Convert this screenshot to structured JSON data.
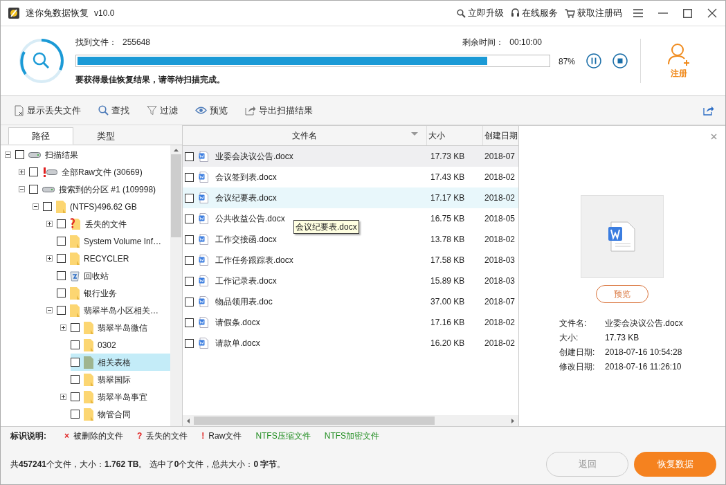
{
  "window": {
    "title": "迷你兔数据恢复",
    "version": "v10.0",
    "actions": [
      {
        "kind": "upgrade",
        "label": "立即升级"
      },
      {
        "kind": "service",
        "label": "在线服务"
      },
      {
        "kind": "cart",
        "label": "获取注册码"
      }
    ]
  },
  "scan": {
    "found_label": "找到文件：",
    "found_value": "255648",
    "remaining_label": "剩余时间：",
    "remaining_value": "00:10:00",
    "level": 0.87,
    "reading": "87%",
    "hint": "要获得最佳恢复结果，请等待扫描完成。",
    "register": "注册"
  },
  "toolbar": [
    {
      "kind": "lost",
      "label": "显示丢失文件"
    },
    {
      "kind": "search",
      "label": "查找"
    },
    {
      "kind": "filter",
      "label": "过滤"
    },
    {
      "kind": "preview",
      "label": "预览"
    },
    {
      "kind": "export",
      "label": "导出扫描结果"
    }
  ],
  "tabs": [
    {
      "label": "路径",
      "selected": true
    },
    {
      "label": "类型",
      "selected": false
    }
  ],
  "tree": [
    {
      "kind": "drive",
      "label": "扫描结果",
      "expanded": true,
      "checked": false,
      "selected": false,
      "children": [
        {
          "kind": "raw",
          "label": "全部Raw文件 (30669)",
          "expanded": false,
          "checked": false,
          "selected": false
        },
        {
          "kind": "drive",
          "label": "搜索到的分区 #1 (109998)",
          "expanded": true,
          "checked": false,
          "selected": false,
          "children": [
            {
              "kind": "folder",
              "label": "(NTFS)496.62 GB",
              "expanded": true,
              "checked": false,
              "selected": false,
              "children": [
                {
                  "kind": "lost",
                  "label": "丢失的文件",
                  "expanded": false,
                  "checked": false,
                  "selected": false
                },
                {
                  "kind": "folder",
                  "label": "System Volume Inf…",
                  "checked": false,
                  "selected": false
                },
                {
                  "kind": "folder",
                  "label": "RECYCLER",
                  "expanded": false,
                  "checked": false,
                  "selected": false
                },
                {
                  "kind": "recycle",
                  "label": "回收站",
                  "checked": false,
                  "selected": false
                },
                {
                  "kind": "folder",
                  "label": "银行业务",
                  "checked": false,
                  "selected": false
                },
                {
                  "kind": "folder",
                  "label": "翡翠半岛小区相关…",
                  "expanded": true,
                  "checked": false,
                  "selected": false,
                  "children": [
                    {
                      "kind": "folder",
                      "label": "翡翠半岛微信",
                      "expanded": false,
                      "checked": false,
                      "selected": false
                    },
                    {
                      "kind": "folder",
                      "label": "0302",
                      "checked": false,
                      "selected": false
                    },
                    {
                      "kind": "folder",
                      "label": "相关表格",
                      "checked": false,
                      "selected": true
                    },
                    {
                      "kind": "folder",
                      "label": "翡翠国际",
                      "checked": false,
                      "selected": false
                    },
                    {
                      "kind": "folder",
                      "label": "翡翠半岛事宜",
                      "expanded": false,
                      "checked": false,
                      "selected": false
                    },
                    {
                      "kind": "folder",
                      "label": "物管合同",
                      "checked": false,
                      "selected": false
                    }
                  ]
                }
              ]
            }
          ]
        }
      ]
    }
  ],
  "table": {
    "columns": [
      "文件名",
      "大小",
      "创建日期"
    ],
    "rows": [
      {
        "name": "业委会决议公告.docx",
        "size": "17.73 KB",
        "date": "2018-07",
        "checked": false,
        "selected": true,
        "hovered": false
      },
      {
        "name": "会议签到表.docx",
        "size": "17.43 KB",
        "date": "2018-02",
        "checked": false,
        "selected": false,
        "hovered": false
      },
      {
        "name": "会议纪要表.docx",
        "size": "17.17 KB",
        "date": "2018-02",
        "checked": false,
        "selected": false,
        "hovered": true
      },
      {
        "name": "公共收益公告.docx",
        "size": "16.75 KB",
        "date": "2018-05",
        "checked": false,
        "selected": false,
        "hovered": false
      },
      {
        "name": "工作交接函.docx",
        "size": "13.78 KB",
        "date": "2018-02",
        "checked": false,
        "selected": false,
        "hovered": false
      },
      {
        "name": "工作任务跟踪表.docx",
        "size": "17.58 KB",
        "date": "2018-03",
        "checked": false,
        "selected": false,
        "hovered": false
      },
      {
        "name": "工作记录表.docx",
        "size": "15.89 KB",
        "date": "2018-03",
        "checked": false,
        "selected": false,
        "hovered": false
      },
      {
        "name": "物品领用表.doc",
        "size": "37.00 KB",
        "date": "2018-07",
        "checked": false,
        "selected": false,
        "hovered": false
      },
      {
        "name": "请假条.docx",
        "size": "17.16 KB",
        "date": "2018-02",
        "checked": false,
        "selected": false,
        "hovered": false
      },
      {
        "name": "请款单.docx",
        "size": "16.20 KB",
        "date": "2018-02",
        "checked": false,
        "selected": false,
        "hovered": false
      }
    ],
    "tooltip": "会议纪要表.docx"
  },
  "details": {
    "preview_button": "预览",
    "fields": [
      {
        "label": "文件名:",
        "value": "业委会决议公告.docx"
      },
      {
        "label": "大小:",
        "value": "17.73 KB"
      },
      {
        "label": "创建日期:",
        "value": "2018-07-16 10:54:28"
      },
      {
        "label": "修改日期:",
        "value": "2018-07-16 11:26:10"
      }
    ]
  },
  "legend": {
    "title": "标识说明:",
    "items": [
      {
        "mark": "×",
        "label": "被删除的文件",
        "color": "#e02020"
      },
      {
        "mark": "?",
        "label": "丢失的文件",
        "color": "#e02020"
      },
      {
        "mark": "!",
        "label": "Raw文件",
        "color": "#e02020"
      },
      {
        "label": "NTFS压缩文件",
        "color": "#1e8c1e"
      },
      {
        "label": "NTFS加密文件",
        "color": "#1e8c1e"
      }
    ]
  },
  "status": "共**457241**个文件，大小：**1.762 TB**。 选中了**0**个文件，总共大小：**0 字节**。",
  "buttons": [
    {
      "label": "返回",
      "disabled": true
    },
    {
      "label": "恢复数据",
      "disabled": false
    }
  ]
}
